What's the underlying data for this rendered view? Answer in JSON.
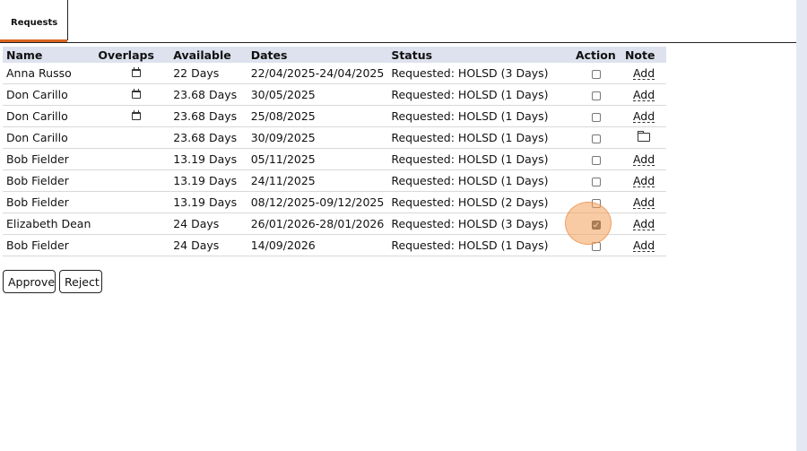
{
  "tabs": [
    {
      "label": "Requests"
    }
  ],
  "table": {
    "headers": {
      "name": "Name",
      "overlaps": "Overlaps",
      "available": "Available",
      "dates": "Dates",
      "status": "Status",
      "action": "Action",
      "note": "Note"
    },
    "rows": [
      {
        "name": "Anna Russo",
        "overlap": true,
        "available": "22 Days",
        "dates": "22/04/2025-24/04/2025",
        "status": "Requested: HOLSD (3 Days)",
        "checked": false,
        "note": "Add"
      },
      {
        "name": "Don Carillo",
        "overlap": true,
        "available": "23.68 Days",
        "dates": "30/05/2025",
        "status": "Requested: HOLSD (1 Days)",
        "checked": false,
        "note": "Add"
      },
      {
        "name": "Don Carillo",
        "overlap": true,
        "available": "23.68 Days",
        "dates": "25/08/2025",
        "status": "Requested: HOLSD (1 Days)",
        "checked": false,
        "note": "Add"
      },
      {
        "name": "Don Carillo",
        "overlap": false,
        "available": "23.68 Days",
        "dates": "30/09/2025",
        "status": "Requested: HOLSD (1 Days)",
        "checked": false,
        "note": "folder-icon"
      },
      {
        "name": "Bob Fielder",
        "overlap": false,
        "available": "13.19 Days",
        "dates": "05/11/2025",
        "status": "Requested: HOLSD (1 Days)",
        "checked": false,
        "note": "Add"
      },
      {
        "name": "Bob Fielder",
        "overlap": false,
        "available": "13.19 Days",
        "dates": "24/11/2025",
        "status": "Requested: HOLSD (1 Days)",
        "checked": false,
        "note": "Add"
      },
      {
        "name": "Bob Fielder",
        "overlap": false,
        "available": "13.19 Days",
        "dates": "08/12/2025-09/12/2025",
        "status": "Requested: HOLSD (2 Days)",
        "checked": false,
        "note": "Add"
      },
      {
        "name": "Elizabeth Dean",
        "overlap": false,
        "available": "24 Days",
        "dates": "26/01/2026-28/01/2026",
        "status": "Requested: HOLSD (3 Days)",
        "checked": true,
        "note": "Add"
      },
      {
        "name": "Bob Fielder",
        "overlap": false,
        "available": "24 Days",
        "dates": "14/09/2026",
        "status": "Requested: HOLSD (1 Days)",
        "checked": false,
        "note": "Add"
      }
    ]
  },
  "buttons": {
    "approve": "Approve",
    "reject": "Reject"
  },
  "icons": {
    "overlap": "calendar-icon",
    "note_alt": "folder-icon"
  },
  "colors": {
    "tab_accent": "#d9641e",
    "header_bg": "#dde2ee",
    "click_highlight": "#f4a05a"
  }
}
